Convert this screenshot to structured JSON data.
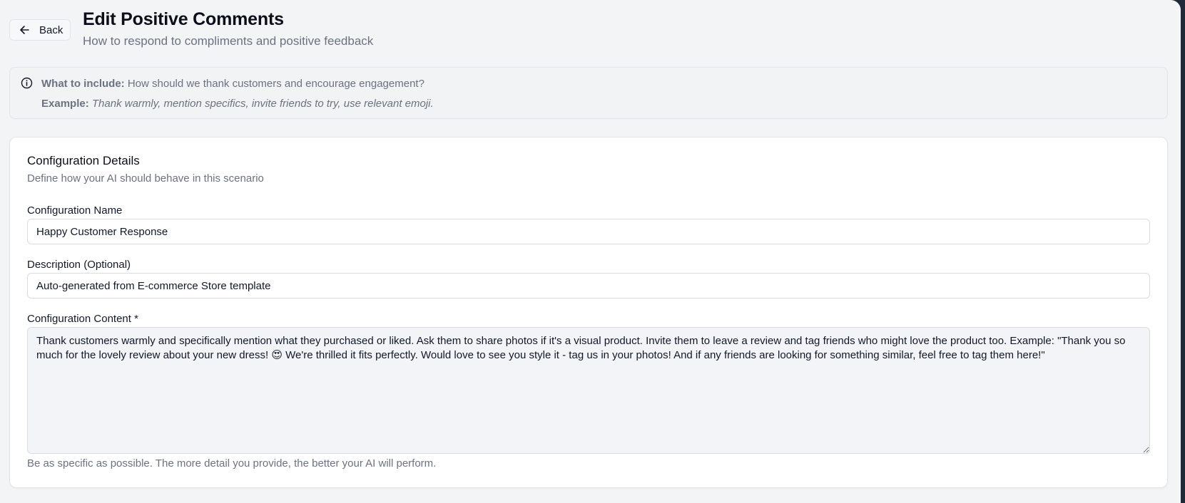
{
  "header": {
    "back_label": "Back",
    "title": "Edit Positive Comments",
    "subtitle": "How to respond to compliments and positive feedback"
  },
  "info": {
    "include_label": "What to include:",
    "include_text": "How should we thank customers and encourage engagement?",
    "example_label": "Example:",
    "example_text": "Thank warmly, mention specifics, invite friends to try, use relevant emoji."
  },
  "card": {
    "title": "Configuration Details",
    "subtitle": "Define how your AI should behave in this scenario",
    "name_label": "Configuration Name",
    "name_value": "Happy Customer Response",
    "description_label": "Description (Optional)",
    "description_value": "Auto-generated from E-commerce Store template",
    "content_label": "Configuration Content *",
    "content_value": "Thank customers warmly and specifically mention what they purchased or liked. Ask them to share photos if it's a visual product. Invite them to leave a review and tag friends who might love the product too. Example: \"Thank you so much for the lovely review about your new dress! 😍 We're thrilled it fits perfectly. Would love to see you style it - tag us in your photos! And if any friends are looking for something similar, feel free to tag them here!\"",
    "helper_text": "Be as specific as possible. The more detail you provide, the better your AI will perform."
  },
  "icons": {
    "back": "arrow-left-icon",
    "info": "info-circle-icon"
  }
}
